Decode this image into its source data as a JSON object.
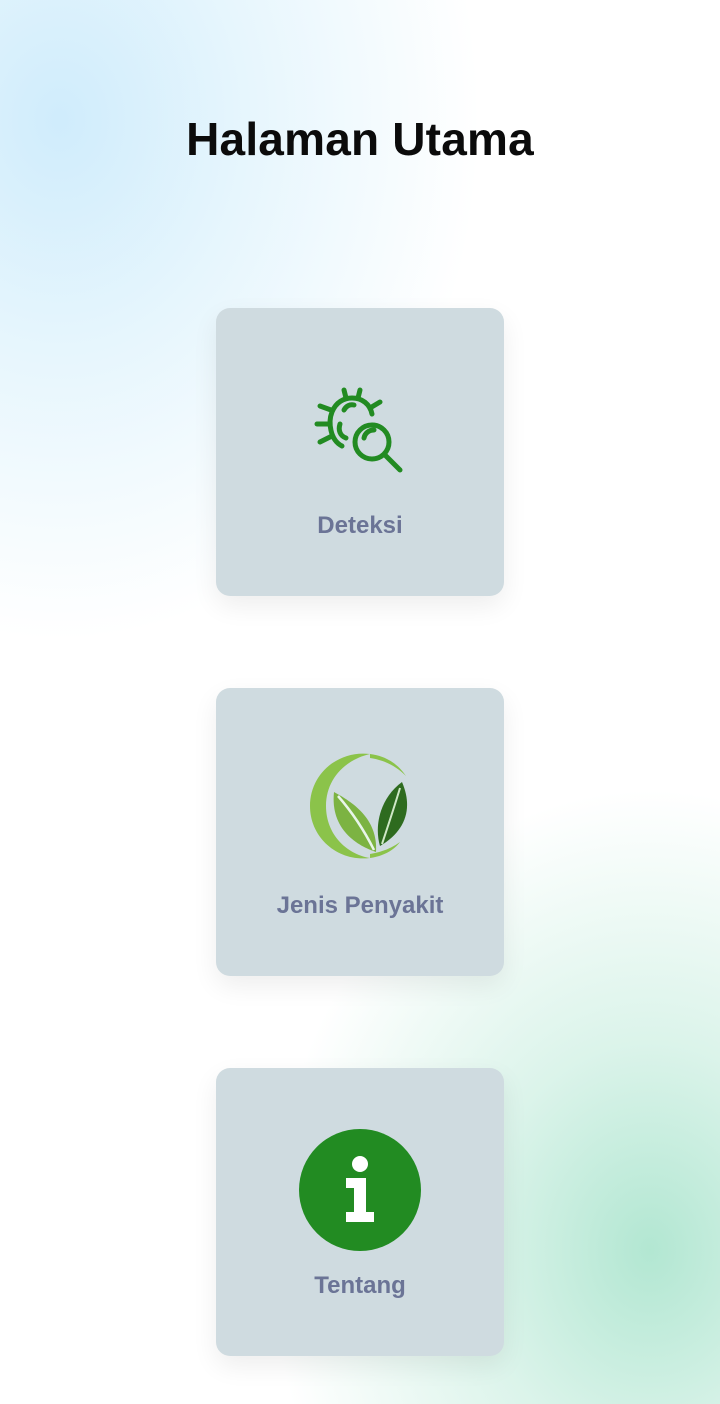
{
  "page": {
    "title": "Halaman Utama"
  },
  "menu": [
    {
      "label": "Deteksi",
      "icon": "bug-search-icon"
    },
    {
      "label": "Jenis Penyakit",
      "icon": "leaf-logo-icon"
    },
    {
      "label": "Tentang",
      "icon": "info-icon"
    }
  ],
  "colors": {
    "card_bg": "#cfdbe0",
    "label": "#6b7496",
    "icon_green": "#228b22",
    "leaf_light": "#8bc34a",
    "leaf_dark": "#2e7d32"
  }
}
